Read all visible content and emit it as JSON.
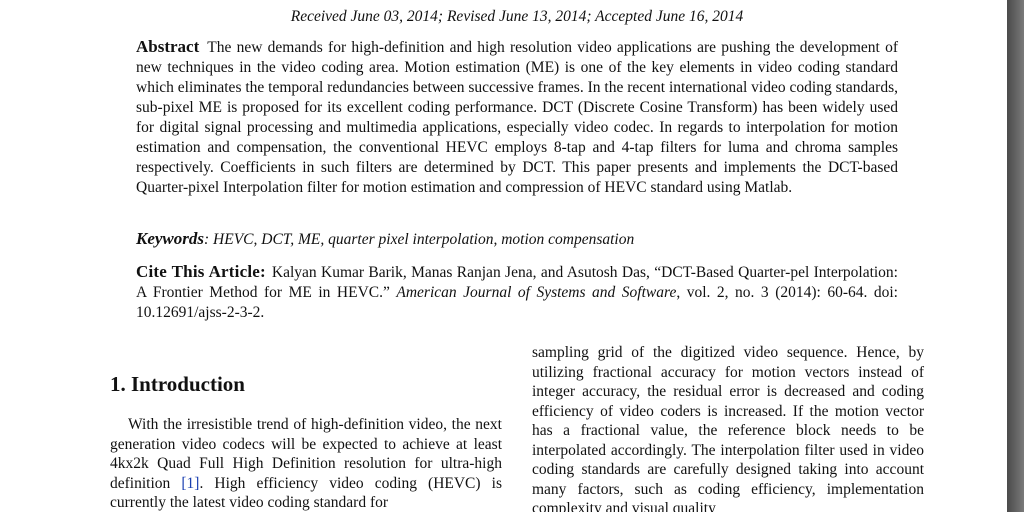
{
  "received_line": "Received June 03, 2014; Revised June 13, 2014; Accepted June 16, 2014",
  "abstract": {
    "label": "Abstract",
    "text": "The new demands for high-definition and high resolution video applications are pushing the development of new techniques in the video coding area. Motion estimation (ME) is one of the key elements in video coding standard which eliminates the temporal redundancies between successive frames. In the recent international video coding standards, sub-pixel ME is proposed for its excellent coding performance. DCT (Discrete Cosine Transform) has been widely used for digital signal processing and multimedia applications, especially video codec. In regards to interpolation for motion estimation and compensation, the conventional HEVC employs 8-tap and 4-tap filters for luma and chroma samples respectively. Coefficients in such filters are determined by DCT. This paper presents and implements the DCT-based Quarter-pixel Interpolation filter for motion estimation and compression of HEVC standard using Matlab."
  },
  "keywords": {
    "label": "Keywords",
    "text": ": HEVC, DCT, ME, quarter pixel interpolation, motion compensation"
  },
  "cite": {
    "label": "Cite This Article:",
    "text_before": "Kalyan Kumar Barik, Manas Ranjan Jena, and Asutosh Das, “DCT-Based Quarter-pel Interpolation: A Frontier Method for ME in HEVC.” ",
    "journal": "American Journal of Systems and Software",
    "text_after": ", vol. 2, no. 3 (2014): 60-64. doi: 10.12691/ajss-2-3-2."
  },
  "intro": {
    "heading": "1. Introduction",
    "para_before": "With the irresistible trend of high-definition video, the next generation video codecs will be expected to achieve at least 4kx2k Quad Full High Definition resolution for ultra-high definition ",
    "ref": "[1]",
    "para_after": ". High efficiency video coding (HEVC) is currently the latest video coding standard for"
  },
  "right_column": "sampling grid of the digitized video sequence. Hence, by utilizing fractional accuracy for motion vectors instead of integer accuracy, the residual error is decreased and coding efficiency of video coders is increased. If the motion vector has a fractional value, the reference block needs to be interpolated accordingly. The interpolation filter used in video coding standards are carefully designed taking into account many factors, such as coding efficiency, implementation complexity and visual quality"
}
